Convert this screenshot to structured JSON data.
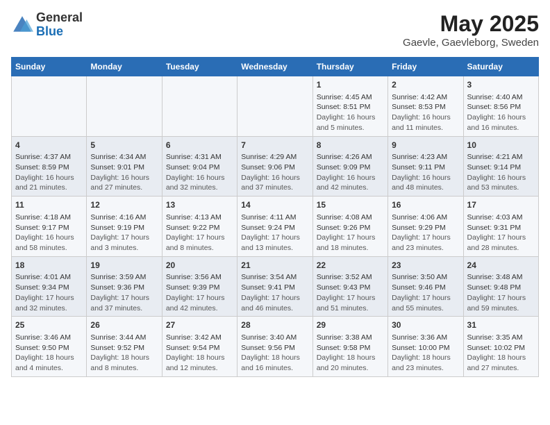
{
  "header": {
    "logo_line1": "General",
    "logo_line2": "Blue",
    "title": "May 2025",
    "subtitle": "Gaevle, Gaevleborg, Sweden"
  },
  "days_of_week": [
    "Sunday",
    "Monday",
    "Tuesday",
    "Wednesday",
    "Thursday",
    "Friday",
    "Saturday"
  ],
  "weeks": [
    [
      {
        "day": "",
        "content": ""
      },
      {
        "day": "",
        "content": ""
      },
      {
        "day": "",
        "content": ""
      },
      {
        "day": "",
        "content": ""
      },
      {
        "day": "1",
        "content": "Sunrise: 4:45 AM\nSunset: 8:51 PM\nDaylight: 16 hours\nand 5 minutes."
      },
      {
        "day": "2",
        "content": "Sunrise: 4:42 AM\nSunset: 8:53 PM\nDaylight: 16 hours\nand 11 minutes."
      },
      {
        "day": "3",
        "content": "Sunrise: 4:40 AM\nSunset: 8:56 PM\nDaylight: 16 hours\nand 16 minutes."
      }
    ],
    [
      {
        "day": "4",
        "content": "Sunrise: 4:37 AM\nSunset: 8:59 PM\nDaylight: 16 hours\nand 21 minutes."
      },
      {
        "day": "5",
        "content": "Sunrise: 4:34 AM\nSunset: 9:01 PM\nDaylight: 16 hours\nand 27 minutes."
      },
      {
        "day": "6",
        "content": "Sunrise: 4:31 AM\nSunset: 9:04 PM\nDaylight: 16 hours\nand 32 minutes."
      },
      {
        "day": "7",
        "content": "Sunrise: 4:29 AM\nSunset: 9:06 PM\nDaylight: 16 hours\nand 37 minutes."
      },
      {
        "day": "8",
        "content": "Sunrise: 4:26 AM\nSunset: 9:09 PM\nDaylight: 16 hours\nand 42 minutes."
      },
      {
        "day": "9",
        "content": "Sunrise: 4:23 AM\nSunset: 9:11 PM\nDaylight: 16 hours\nand 48 minutes."
      },
      {
        "day": "10",
        "content": "Sunrise: 4:21 AM\nSunset: 9:14 PM\nDaylight: 16 hours\nand 53 minutes."
      }
    ],
    [
      {
        "day": "11",
        "content": "Sunrise: 4:18 AM\nSunset: 9:17 PM\nDaylight: 16 hours\nand 58 minutes."
      },
      {
        "day": "12",
        "content": "Sunrise: 4:16 AM\nSunset: 9:19 PM\nDaylight: 17 hours\nand 3 minutes."
      },
      {
        "day": "13",
        "content": "Sunrise: 4:13 AM\nSunset: 9:22 PM\nDaylight: 17 hours\nand 8 minutes."
      },
      {
        "day": "14",
        "content": "Sunrise: 4:11 AM\nSunset: 9:24 PM\nDaylight: 17 hours\nand 13 minutes."
      },
      {
        "day": "15",
        "content": "Sunrise: 4:08 AM\nSunset: 9:26 PM\nDaylight: 17 hours\nand 18 minutes."
      },
      {
        "day": "16",
        "content": "Sunrise: 4:06 AM\nSunset: 9:29 PM\nDaylight: 17 hours\nand 23 minutes."
      },
      {
        "day": "17",
        "content": "Sunrise: 4:03 AM\nSunset: 9:31 PM\nDaylight: 17 hours\nand 28 minutes."
      }
    ],
    [
      {
        "day": "18",
        "content": "Sunrise: 4:01 AM\nSunset: 9:34 PM\nDaylight: 17 hours\nand 32 minutes."
      },
      {
        "day": "19",
        "content": "Sunrise: 3:59 AM\nSunset: 9:36 PM\nDaylight: 17 hours\nand 37 minutes."
      },
      {
        "day": "20",
        "content": "Sunrise: 3:56 AM\nSunset: 9:39 PM\nDaylight: 17 hours\nand 42 minutes."
      },
      {
        "day": "21",
        "content": "Sunrise: 3:54 AM\nSunset: 9:41 PM\nDaylight: 17 hours\nand 46 minutes."
      },
      {
        "day": "22",
        "content": "Sunrise: 3:52 AM\nSunset: 9:43 PM\nDaylight: 17 hours\nand 51 minutes."
      },
      {
        "day": "23",
        "content": "Sunrise: 3:50 AM\nSunset: 9:46 PM\nDaylight: 17 hours\nand 55 minutes."
      },
      {
        "day": "24",
        "content": "Sunrise: 3:48 AM\nSunset: 9:48 PM\nDaylight: 17 hours\nand 59 minutes."
      }
    ],
    [
      {
        "day": "25",
        "content": "Sunrise: 3:46 AM\nSunset: 9:50 PM\nDaylight: 18 hours\nand 4 minutes."
      },
      {
        "day": "26",
        "content": "Sunrise: 3:44 AM\nSunset: 9:52 PM\nDaylight: 18 hours\nand 8 minutes."
      },
      {
        "day": "27",
        "content": "Sunrise: 3:42 AM\nSunset: 9:54 PM\nDaylight: 18 hours\nand 12 minutes."
      },
      {
        "day": "28",
        "content": "Sunrise: 3:40 AM\nSunset: 9:56 PM\nDaylight: 18 hours\nand 16 minutes."
      },
      {
        "day": "29",
        "content": "Sunrise: 3:38 AM\nSunset: 9:58 PM\nDaylight: 18 hours\nand 20 minutes."
      },
      {
        "day": "30",
        "content": "Sunrise: 3:36 AM\nSunset: 10:00 PM\nDaylight: 18 hours\nand 23 minutes."
      },
      {
        "day": "31",
        "content": "Sunrise: 3:35 AM\nSunset: 10:02 PM\nDaylight: 18 hours\nand 27 minutes."
      }
    ]
  ]
}
